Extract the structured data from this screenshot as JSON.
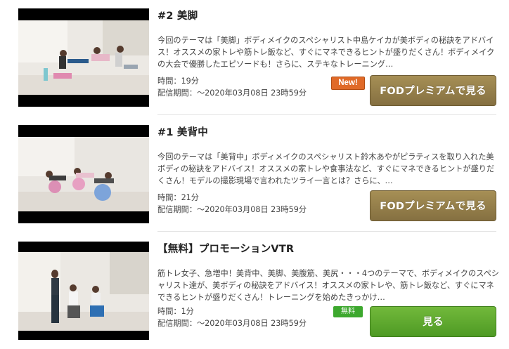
{
  "episodes": [
    {
      "title": "#2 美脚",
      "description": "今回のテーマは「美脚」ボディメイクのスペシャリスト中島ケイカが美ボディの秘訣をアドバイス！オススメの家トレや筋トレ飯など、すぐにマネできるヒントが盛りだくさん！ボディメイクの大会で優勝したエピソードも！さらに、ステキなトレーニング…",
      "duration": "時間：19分",
      "period": "配信期間：～2020年03月08日 23時59分",
      "badge": "New!",
      "button_label": "FODプレミアムで見る"
    },
    {
      "title": "#1 美背中",
      "description": "今回のテーマは「美背中」ボディメイクのスペシャリスト鈴木あやがピラティスを取り入れた美ボディの秘訣をアドバイス！オススメの家トレや食事法など、すぐにマネできるヒントが盛りだくさん！モデルの撮影現場で言われたツライ一言とは？さらに、…",
      "duration": "時間：21分",
      "period": "配信期間：～2020年03月08日 23時59分",
      "button_label": "FODプレミアムで見る"
    },
    {
      "title": "【無料】プロモーションVTR",
      "description": "筋トレ女子、急増中！美背中、美脚、美腹筋、美尻・・・4つのテーマで、ボディメイクのスペシャリスト達が、美ボディの秘訣をアドバイス！オススメの家トレや、筋トレ飯など、すぐにマネできるヒントが盛りだくさん！トレーニングを始めたきっかけ…",
      "duration": "時間：1分",
      "period": "配信期間：～2020年03月08日 23時59分",
      "badge": "無料",
      "button_label": "見る"
    }
  ],
  "colors": {
    "premium_button": "#967f4b",
    "free_button": "#5faa2f",
    "new_badge": "#e06a28",
    "free_badge": "#3da82e"
  }
}
